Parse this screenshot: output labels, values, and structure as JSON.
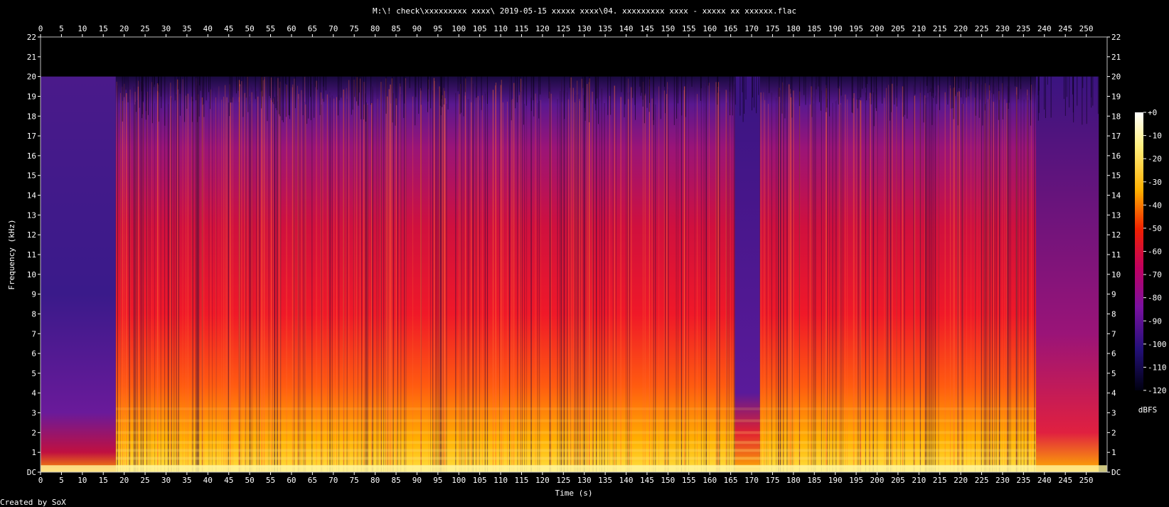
{
  "footer": "Created by SoX",
  "chart_data": {
    "type": "heatmap",
    "title": "M:\\! check\\xxxxxxxxx xxxx\\ 2019-05-15  xxxxx xxxx\\04. xxxxxxxxx xxxx - xxxxx xx xxxxxx.flac",
    "xlabel": "Time (s)",
    "ylabel": "Frequency (kHz)",
    "xlim": [
      0,
      255
    ],
    "ylim": [
      0,
      22
    ],
    "x_ticks": [
      "0",
      "5",
      "10",
      "15",
      "20",
      "25",
      "30",
      "35",
      "40",
      "45",
      "50",
      "55",
      "60",
      "65",
      "70",
      "75",
      "80",
      "85",
      "90",
      "95",
      "100",
      "105",
      "110",
      "115",
      "120",
      "125",
      "130",
      "135",
      "140",
      "145",
      "150",
      "155",
      "160",
      "165",
      "170",
      "175",
      "180",
      "185",
      "190",
      "195",
      "200",
      "205",
      "210",
      "215",
      "220",
      "225",
      "230",
      "235",
      "240",
      "245",
      "250"
    ],
    "y_ticks": [
      "DC",
      "1",
      "2",
      "3",
      "4",
      "5",
      "6",
      "7",
      "8",
      "9",
      "10",
      "11",
      "12",
      "13",
      "14",
      "15",
      "16",
      "17",
      "18",
      "19",
      "20",
      "21",
      "22"
    ],
    "colorbar": {
      "label": "dBFS",
      "range": [
        -120,
        0
      ],
      "ticks": [
        "+0",
        "-10",
        "-20",
        "-30",
        "-40",
        "-50",
        "-60",
        "-70",
        "-80",
        "-90",
        "-100",
        "-110",
        "-120"
      ]
    },
    "grid": false,
    "spectral_cutoff_khz": 20,
    "segments": [
      {
        "t_start": 0,
        "t_end": 18,
        "level": "quiet intro, sparse energy"
      },
      {
        "t_start": 18,
        "t_end": 166,
        "level": "full band, loud"
      },
      {
        "t_start": 166,
        "t_end": 172,
        "level": "reduced energy above 3 kHz"
      },
      {
        "t_start": 172,
        "t_end": 238,
        "level": "full band, loud"
      },
      {
        "t_start": 238,
        "t_end": 253,
        "level": "quieter outro"
      }
    ],
    "colors": {
      "low": "#000000",
      "mid_low": "#2b0d7a",
      "mid": "#8a1aa0",
      "mid_high": "#f01030",
      "high": "#ffd020",
      "peak": "#ffffff"
    }
  }
}
